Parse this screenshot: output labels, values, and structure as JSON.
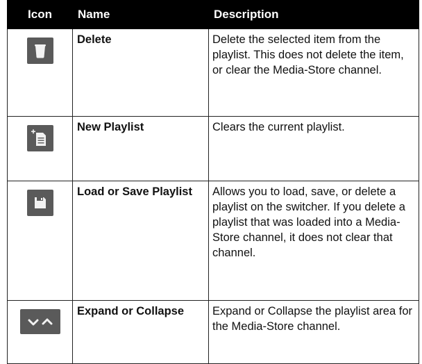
{
  "table": {
    "headers": {
      "icon": "Icon",
      "name": "Name",
      "description": "Description"
    },
    "rows": [
      {
        "icon": "trash-icon",
        "name": "Delete",
        "description": "Delete the selected item from the playlist. This does not delete the item, or clear the Media-Store channel."
      },
      {
        "icon": "new-playlist-icon",
        "name": "New Playlist",
        "description": "Clears the current playlist."
      },
      {
        "icon": "save-disk-icon",
        "name": "Load or Save Playlist",
        "description": "Allows you to load, save, or delete a playlist on the switcher. If you delete a playlist that was loaded into a Media-Store channel, it does not clear that channel."
      },
      {
        "icon": "expand-collapse-chevrons-icon",
        "name": "Expand or Collapse",
        "description": "Expand or Collapse the playlist area for the Media-Store channel."
      }
    ]
  },
  "colors": {
    "header_bg": "#000000",
    "icon_bg": "#5a5a5a",
    "icon_fg": "#f2f2f2"
  }
}
